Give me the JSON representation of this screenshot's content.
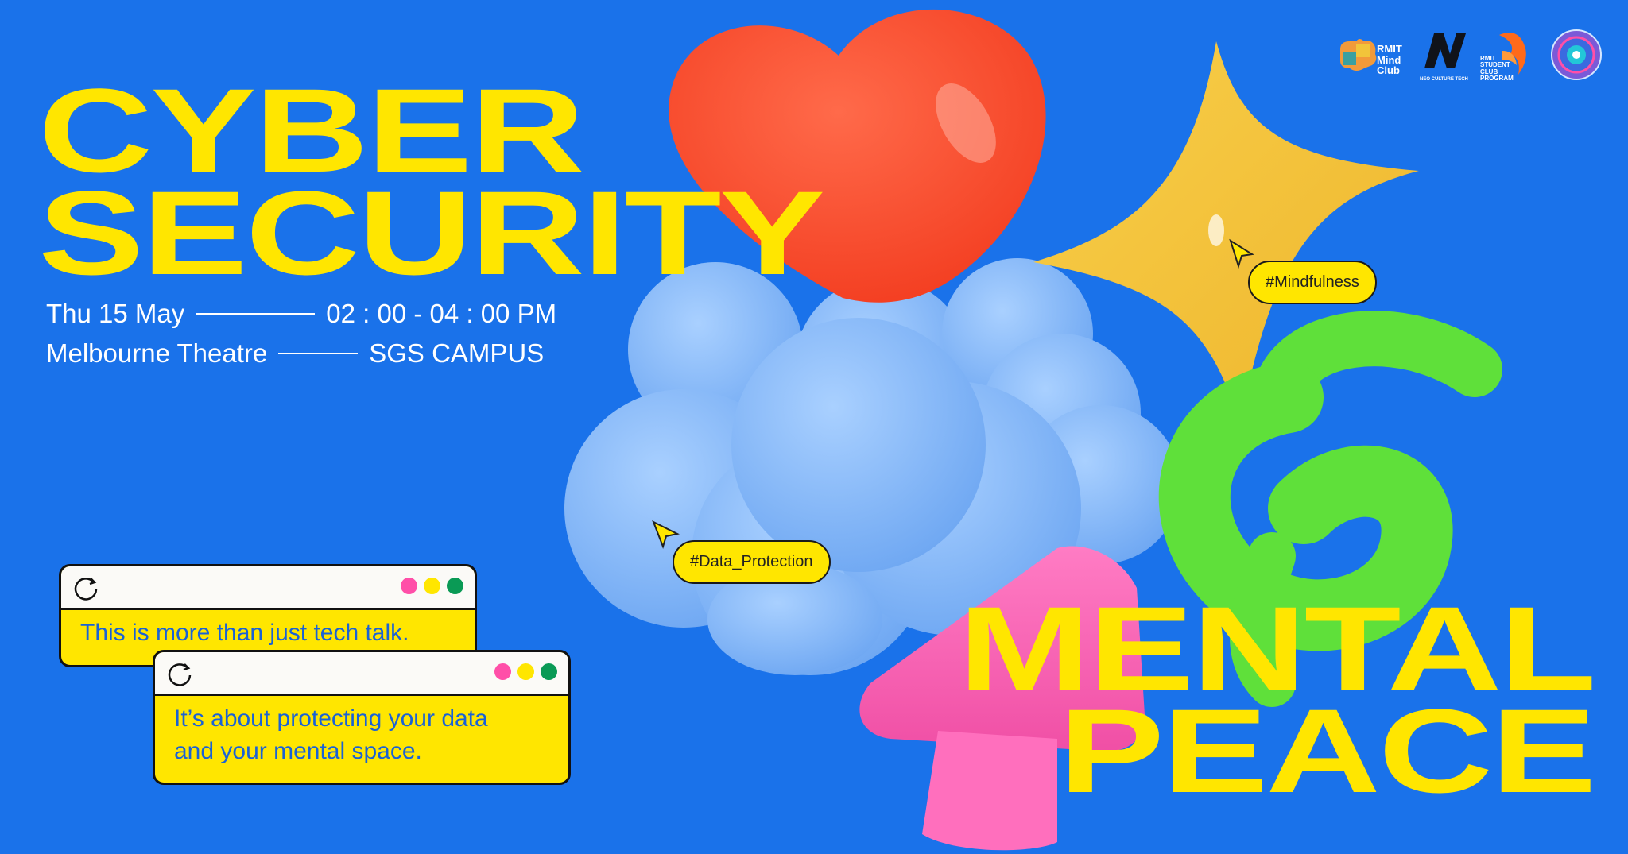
{
  "title_top": [
    "CYBER",
    "SECURITY"
  ],
  "title_bottom": [
    "MENTAL",
    "PEACE"
  ],
  "info": {
    "date": "Thu 15 May",
    "time": "02 : 00 - 04 : 00 PM",
    "venue": "Melbourne Theatre",
    "campus": "SGS CAMPUS"
  },
  "tags": {
    "mindfulness": "#Mindfulness",
    "data_protection": "#Data_Protection"
  },
  "windows": {
    "first": "This is more than just tech talk.",
    "second_line1": "It’s about protecting your data",
    "second_line2": "and your mental space."
  },
  "logos": {
    "mind_club": [
      "RMIT",
      "Mind",
      "Club"
    ],
    "neo_culture": "NEO CULTURE TECH",
    "student_club": [
      "RMIT",
      "STUDENT",
      "CLUB",
      "PROGRAM"
    ]
  },
  "colors": {
    "background": "#1a72ea",
    "accent_yellow": "#ffe600",
    "heart": "#ff4b2e",
    "star": "#f3c23c",
    "cloud": "#85b8f6",
    "spiral": "#5fe03a",
    "arrow": "#ff63b6",
    "dot_pink": "#ff4fa8",
    "dot_yellow": "#ffe600",
    "dot_green": "#0a9a55"
  },
  "icons": [
    "refresh-icon",
    "cursor-icon",
    "heart-shape",
    "star-shape",
    "cloud-shape",
    "spiral-shape",
    "arrow-shape"
  ]
}
